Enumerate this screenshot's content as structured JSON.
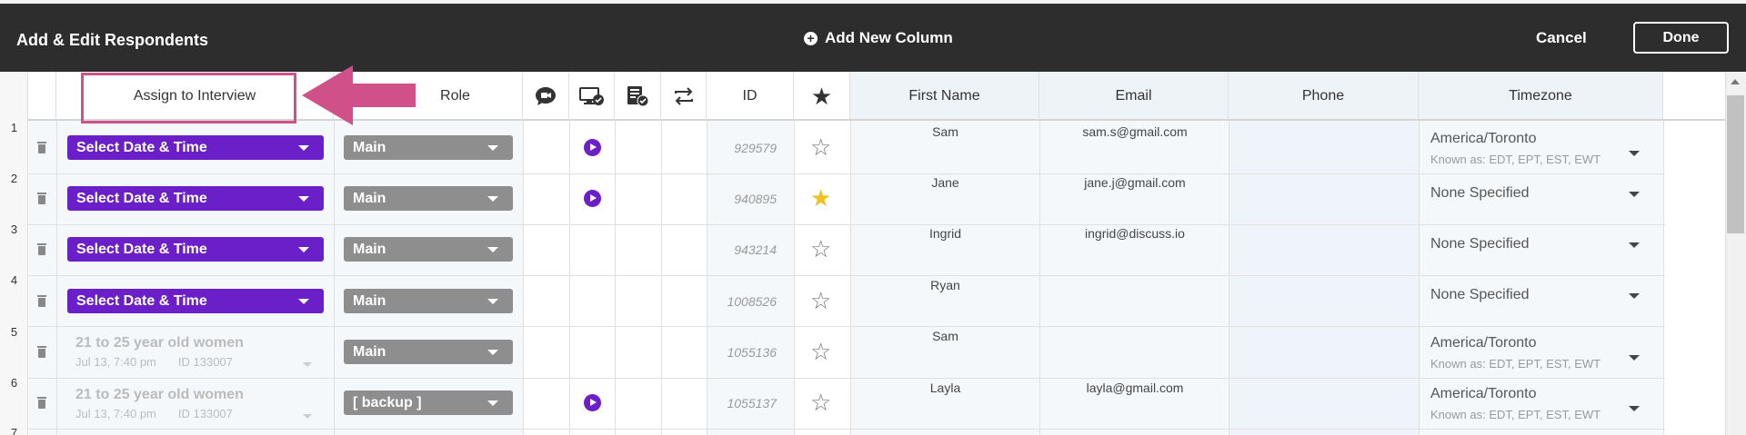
{
  "header": {
    "title": "Add & Edit Respondents",
    "add_column": "Add New Column",
    "cancel": "Cancel",
    "done": "Done"
  },
  "columns": {
    "assign": "Assign to Interview",
    "role": "Role",
    "id": "ID",
    "first_name": "First Name",
    "email": "Email",
    "phone": "Phone",
    "timezone": "Timezone"
  },
  "icons": [
    "chat-icon",
    "screen-share-icon",
    "form-check-icon",
    "swap-icon",
    "star-icon"
  ],
  "accent": "#6b1fc9",
  "rows": [
    {
      "num": "1",
      "assign": "Select Date & Time",
      "role": "Main",
      "play": true,
      "id": "929579",
      "starred": false,
      "first": "Sam",
      "email": "sam.s@gmail.com",
      "tz": "America/Toronto",
      "tz_sub": "Known as: EDT, EPT, EST, EWT"
    },
    {
      "num": "2",
      "assign": "Select Date & Time",
      "role": "Main",
      "play": true,
      "id": "940895",
      "starred": true,
      "first": "Jane",
      "email": "jane.j@gmail.com",
      "tz": "None Specified",
      "tz_sub": ""
    },
    {
      "num": "3",
      "assign": "Select Date & Time",
      "role": "Main",
      "play": false,
      "id": "943214",
      "starred": false,
      "first": "Ingrid",
      "email": "ingrid@discuss.io",
      "tz": "None Specified",
      "tz_sub": ""
    },
    {
      "num": "4",
      "assign": "Select Date & Time",
      "role": "Main",
      "play": false,
      "id": "1008526",
      "starred": false,
      "first": "Ryan",
      "email": "",
      "tz": "None Specified",
      "tz_sub": ""
    },
    {
      "num": "5",
      "assigned_title": "21 to 25 year old women",
      "assigned_date": "Jul 13, 7:40 pm",
      "assigned_id": "ID 133007",
      "role": "Main",
      "play": false,
      "id": "1055136",
      "starred": false,
      "first": "Sam",
      "email": "",
      "tz": "America/Toronto",
      "tz_sub": "Known as: EDT, EPT, EST, EWT"
    },
    {
      "num": "6",
      "assigned_title": "21 to 25 year old women",
      "assigned_date": "Jul 13, 7:40 pm",
      "assigned_id": "ID 133007",
      "role": "[ backup ]",
      "play": true,
      "id": "1055137",
      "starred": false,
      "first": "Layla",
      "email": "layla@gmail.com",
      "tz": "America/Toronto",
      "tz_sub": "Known as: EDT, EPT, EST, EWT"
    },
    {
      "num": "7"
    }
  ]
}
